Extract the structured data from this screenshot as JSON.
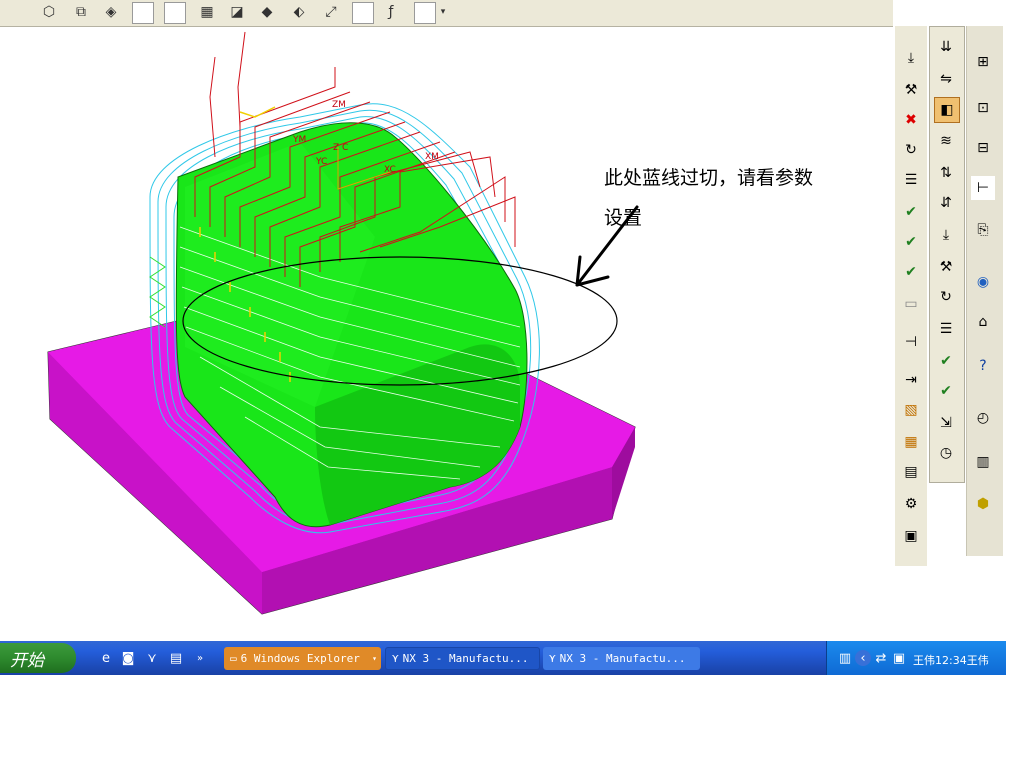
{
  "annotation": {
    "line1": "此处蓝线过切，请看参数",
    "line2": "设置"
  },
  "model_labels": {
    "zm": "ZM",
    "ym": "YM",
    "zc": "Z C",
    "yc": "YC",
    "xm": "XM",
    "xc": "XC"
  },
  "taskbar": {
    "start_label": "开始",
    "tasks": [
      {
        "label": "6 Windows Explorer"
      },
      {
        "label": "NX 3 - Manufactu..."
      },
      {
        "label": "NX 3 - Manufactu..."
      }
    ],
    "tray_text": "王伟12:34王伟"
  },
  "icons": {
    "quick_launch": [
      "ie-icon",
      "outlook-icon",
      "nx-icon",
      "calc-icon"
    ],
    "colors": {
      "part": "#19e619",
      "base": "#e017e6",
      "toolpath_red": "#d0101a",
      "toolpath_cyan": "#30c8e8",
      "taskbar": "#245edb"
    }
  }
}
